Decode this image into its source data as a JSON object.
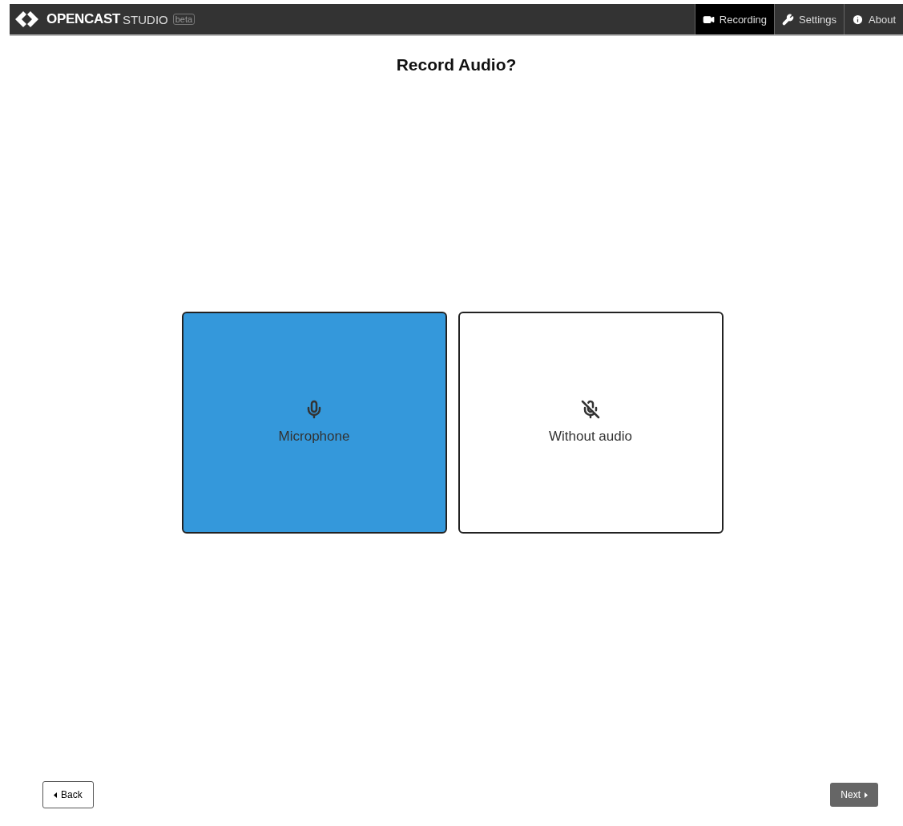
{
  "header": {
    "logo": {
      "brand": "OPENCAST",
      "product": "STUDIO",
      "badge": "beta"
    },
    "nav": [
      {
        "kind": "video",
        "label": "Recording",
        "selected": true
      },
      {
        "kind": "wrench",
        "label": "Settings",
        "selected": false
      },
      {
        "kind": "info",
        "label": "About",
        "selected": false
      }
    ]
  },
  "title": "Record Audio?",
  "options": [
    {
      "kind": "microphone",
      "label": "Microphone",
      "selected": true
    },
    {
      "kind": "muted",
      "label": "Without audio",
      "selected": false
    }
  ],
  "footer": {
    "back": "Back",
    "next": "Next"
  }
}
